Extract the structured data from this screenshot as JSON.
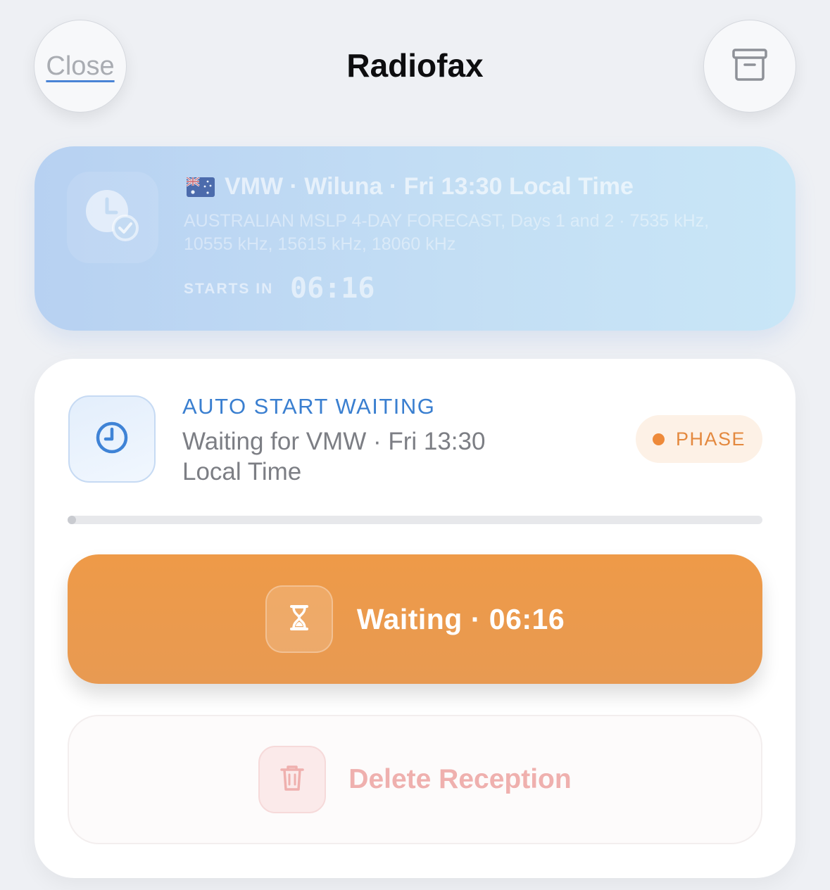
{
  "header": {
    "close_label": "Close",
    "title": "Radiofax",
    "archive_icon": "archive-box-icon"
  },
  "schedule": {
    "flag": "australia-flag",
    "line1": "VMW · Wiluna · Fri 13:30 Local Time",
    "description": "AUSTRALIAN MSLP 4-DAY FORECAST, Days 1 and 2 · 7535 kHz, 10555 kHz, 15615 kHz, 18060 kHz",
    "starts_label": "STARTS IN",
    "countdown": "06:16",
    "icon": "clock-check-icon"
  },
  "status": {
    "icon": "clock-icon",
    "title": "AUTO START WAITING",
    "detail": "Waiting for VMW · Fri 13:30 Local Time",
    "badge": "PHASE",
    "badge_color": "#ee8a3a",
    "progress": 0.01
  },
  "actions": {
    "waiting_label": "Waiting · 06:16",
    "waiting_icon": "hourglass-icon",
    "waiting_color": "#ee9a48",
    "delete_label": "Delete Reception",
    "delete_icon": "trash-icon"
  }
}
